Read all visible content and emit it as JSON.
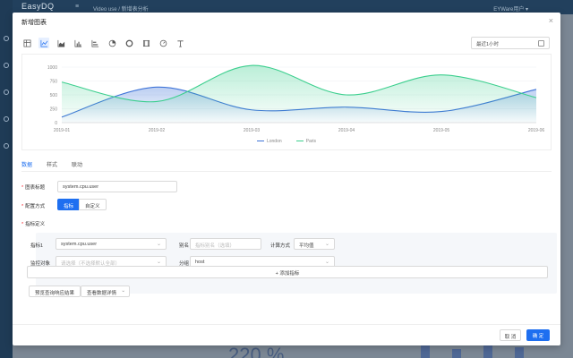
{
  "background_app": {
    "logo": "EasyDQ",
    "menu_icon": "hamburger-icon",
    "breadcrumb": "Video use / 新增表分析",
    "user": "EYWare用户 ▾",
    "big_number": "220 %"
  },
  "modal": {
    "title": "新增图表",
    "close_icon": "close-icon",
    "toolbar_icons": [
      "table-icon",
      "line-chart-icon",
      "area-chart-icon",
      "bar-chart-icon",
      "column-chart-icon",
      "pie-chart-icon",
      "ring-chart-icon",
      "funnel-icon",
      "gauge-icon",
      "text-icon"
    ],
    "time_range": "最近1小时",
    "calendar_icon": "calendar-icon"
  },
  "chart_data": {
    "type": "line",
    "categories": [
      "2019-01",
      "2019-02",
      "2019-03",
      "2019-04",
      "2019-05",
      "2019-06"
    ],
    "yticks": [
      "1000",
      "750",
      "500",
      "250",
      "0"
    ],
    "ylim": [
      0,
      1000
    ],
    "series": [
      {
        "name": "London",
        "color": "#3f74d8",
        "values": [
          100,
          640,
          230,
          280,
          200,
          600
        ]
      },
      {
        "name": "Paris",
        "color": "#3ccf8e",
        "values": [
          730,
          380,
          1030,
          500,
          860,
          450
        ]
      }
    ],
    "legend_position": "bottom-center",
    "grid": true
  },
  "tabs": [
    "数据",
    "样式",
    "联动"
  ],
  "form": {
    "chart_title_label": "图表标题",
    "chart_title_value": "system.cpu.user",
    "config_mode_label": "配置方式",
    "config_modes": [
      "指标",
      "自定义"
    ],
    "metric_def_label": "指标定义",
    "metric1_label": "指标1",
    "metric1_value": "system.cpu.user",
    "alias_label": "别名",
    "alias_placeholder": "指标别名（选填）",
    "calc_label": "计算方式",
    "calc_value": "平均值",
    "monitor_label": "监控对象",
    "monitor_placeholder": "请选择（不选择默认全部）",
    "group_label": "分组",
    "group_value": "host",
    "add_metric": "+ 添加指标",
    "btn_query": "预览查询响应结果",
    "btn_detail": "查看数据详情",
    "chevron_icon": "chevron-down-icon"
  },
  "footer": {
    "cancel": "取 消",
    "ok": "确 定"
  }
}
